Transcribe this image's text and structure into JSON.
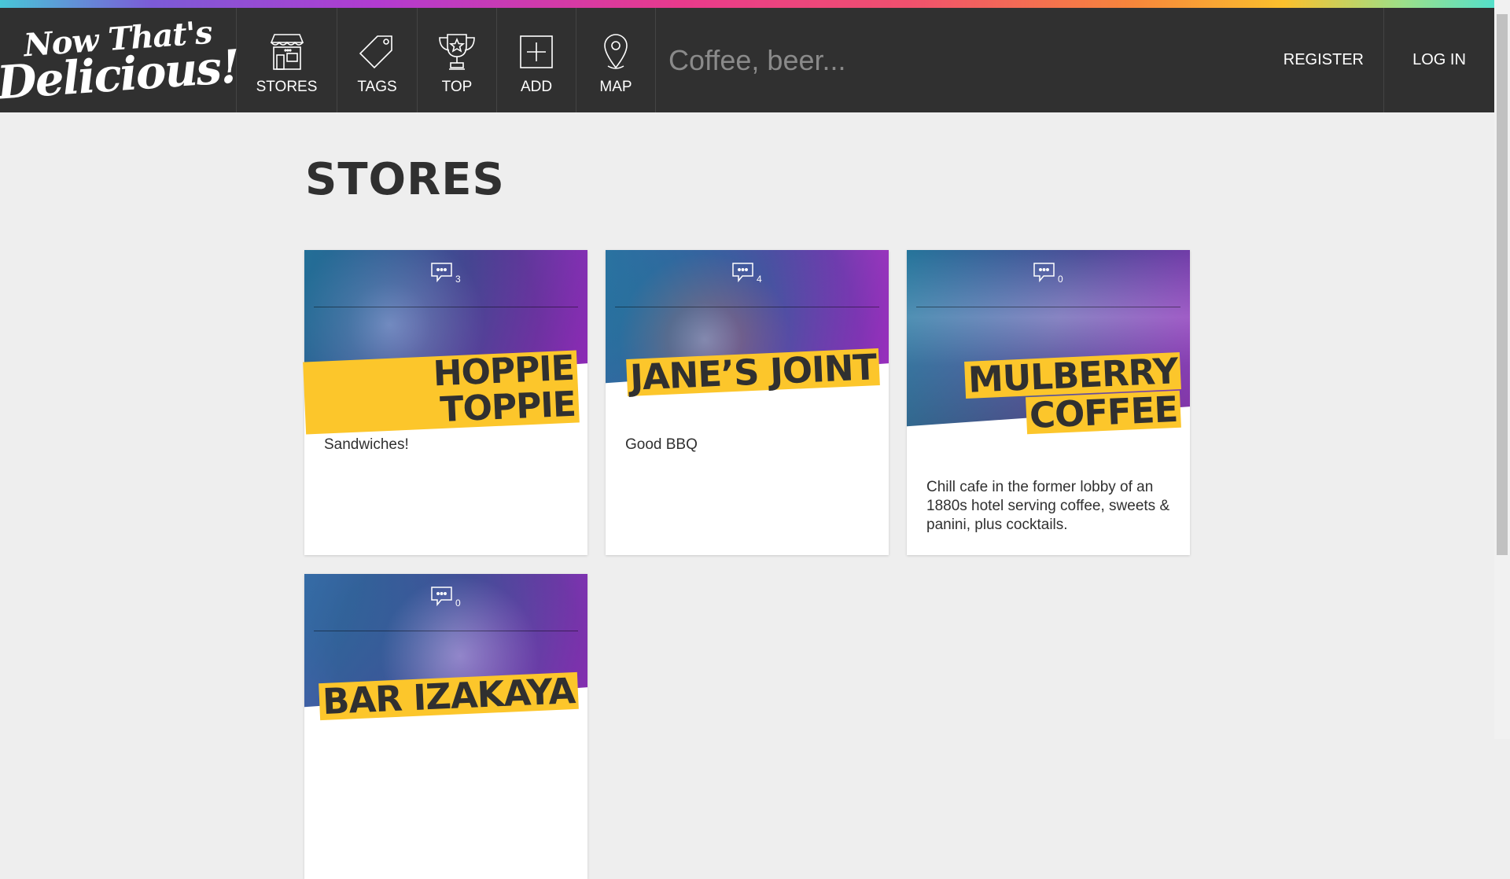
{
  "nav": {
    "logo_line1": "Now That's",
    "logo_line2": "Delicious!",
    "items": [
      {
        "label": "STORES",
        "icon": "store-icon"
      },
      {
        "label": "TAGS",
        "icon": "tag-icon"
      },
      {
        "label": "TOP",
        "icon": "trophy-icon"
      },
      {
        "label": "ADD",
        "icon": "plus-box-icon"
      },
      {
        "label": "MAP",
        "icon": "map-pin-icon"
      }
    ],
    "search_placeholder": "Coffee, beer...",
    "register_label": "REGISTER",
    "login_label": "LOG IN"
  },
  "main": {
    "title": "STORES",
    "stores": [
      {
        "name": "HOPPIE TOPPIE",
        "comments": "3",
        "description": "Sandwiches!"
      },
      {
        "name": "JANE’S JOINT",
        "comments": "4",
        "description": "Good BBQ"
      },
      {
        "name_line1": "MULBERRY",
        "name_line2": "COFFEE",
        "comments": "0",
        "description": "Chill cafe in the former lobby of an 1880s hotel serving coffee, sweets & panini, plus cocktails."
      },
      {
        "name": "BAR IZAKAYA",
        "comments": "0",
        "description": ""
      }
    ]
  },
  "colors": {
    "nav_bg": "#303030",
    "page_bg": "#eeeeee",
    "highlight": "#fcc62b"
  }
}
